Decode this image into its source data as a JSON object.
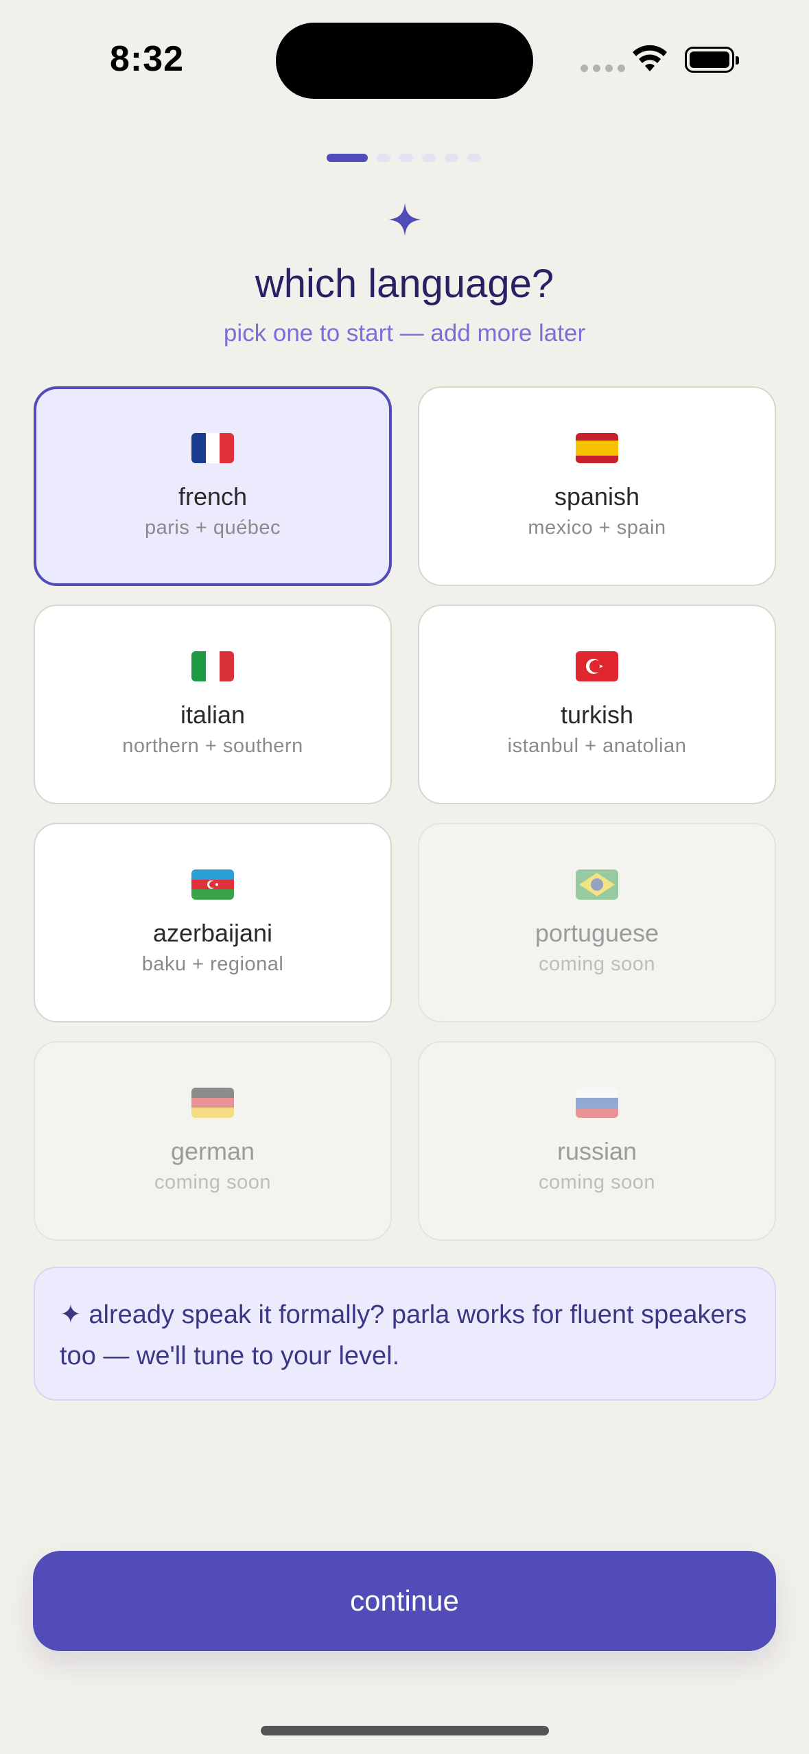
{
  "status_bar": {
    "time": "8:32"
  },
  "header": {
    "title": "which language?",
    "subtitle": "pick one to start — add more later"
  },
  "languages": [
    {
      "name": "french",
      "region": "paris + québec",
      "flag": "flag-france-icon",
      "state": "selected"
    },
    {
      "name": "spanish",
      "region": "mexico + spain",
      "flag": "flag-spain-icon",
      "state": "available"
    },
    {
      "name": "italian",
      "region": "northern + southern",
      "flag": "flag-italy-icon",
      "state": "available"
    },
    {
      "name": "turkish",
      "region": "istanbul + anatolian",
      "flag": "flag-turkey-icon",
      "state": "available"
    },
    {
      "name": "azerbaijani",
      "region": "baku + regional",
      "flag": "flag-azerbaijan-icon",
      "state": "available"
    },
    {
      "name": "portuguese",
      "region": "coming soon",
      "flag": "flag-brazil-icon",
      "state": "disabled"
    },
    {
      "name": "german",
      "region": "coming soon",
      "flag": "flag-germany-icon",
      "state": "disabled"
    },
    {
      "name": "russian",
      "region": "coming soon",
      "flag": "flag-russia-icon",
      "state": "disabled"
    }
  ],
  "note": {
    "text": "✦ already speak it formally? parla works for fluent speakers too — we'll tune to your level."
  },
  "footer": {
    "continue_label": "continue"
  },
  "colors": {
    "accent": "#524cb8",
    "background": "#f2f0ea",
    "selected_card": "#eceafd",
    "title": "#262263"
  }
}
